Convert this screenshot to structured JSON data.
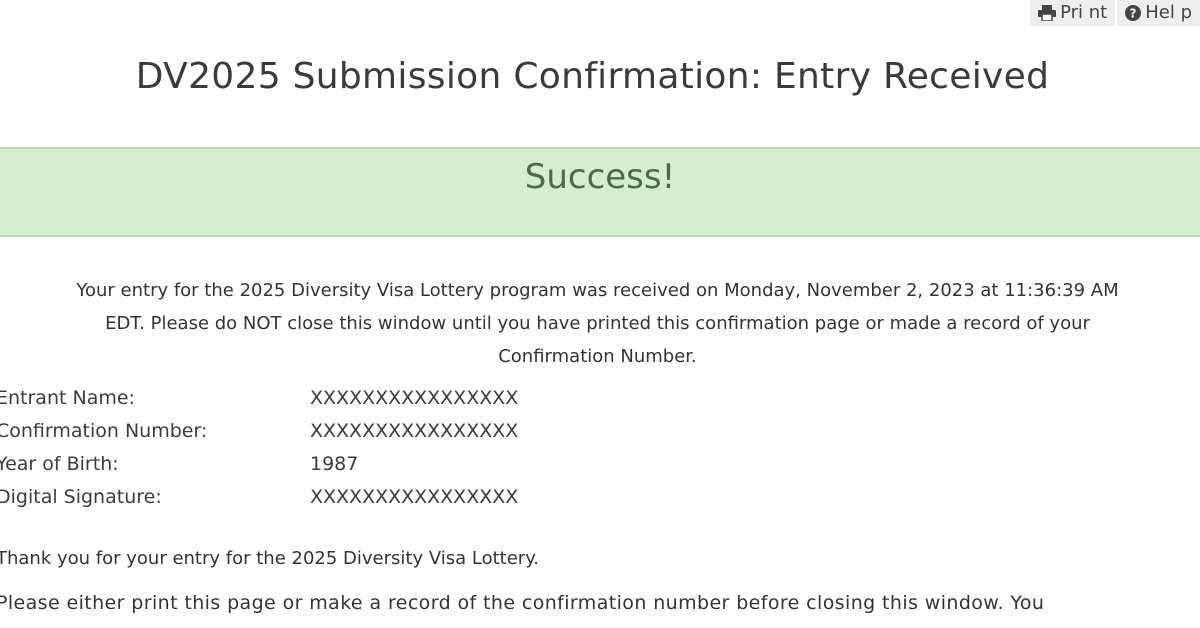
{
  "toolbar": {
    "print_label": "Pri nt",
    "help_label": "Hel p"
  },
  "header": {
    "title": "DV2025 Submission Confirmation: Entry Received"
  },
  "banner": {
    "text": "Success!",
    "background_color": "#d6eed0",
    "text_color": "#4a6e42"
  },
  "message": {
    "line1": "Your entry for the 2025 Diversity Visa Lottery program was received on Monday, November 2, 2023 at 11:36:39 AM",
    "line2": "EDT. Please do NOT close this window until you have printed this confirmation page or made a record of your",
    "line3": "Confirmation Number."
  },
  "details": [
    {
      "label": "Entrant Name:",
      "value": "XXXXXXXXXXXXXXXX"
    },
    {
      "label": "Confirmation Number:",
      "value": "XXXXXXXXXXXXXXXX"
    },
    {
      "label": "Year of Birth:",
      "value": "1987"
    },
    {
      "label": "Digital Signature:",
      "value": "XXXXXXXXXXXXXXXX"
    }
  ],
  "footer": {
    "thanks": "Thank you for your entry for the 2025 Diversity Visa Lottery.",
    "instructions": "Please either print this page or make a record of the confirmation number before closing this window. You"
  }
}
